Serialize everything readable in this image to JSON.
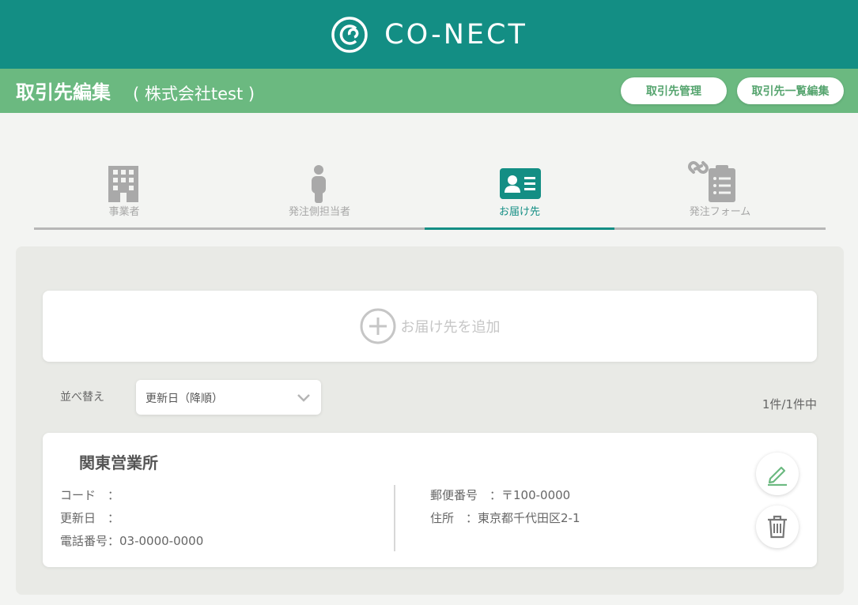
{
  "brand": {
    "name": "CO-NECT",
    "icon": "conect-logo-icon"
  },
  "header": {
    "title": "取引先編集",
    "subtitle": "( 株式会社test )",
    "buttons": {
      "manage": "取引先管理",
      "list_edit": "取引先一覧編集"
    }
  },
  "tabs": [
    {
      "label": "事業者",
      "icon": "building-icon",
      "active": false
    },
    {
      "label": "発注側担当者",
      "icon": "person-icon",
      "active": false
    },
    {
      "label": "お届け先",
      "icon": "id-card-icon",
      "active": true
    },
    {
      "label": "発注フォーム",
      "icon": "linked-clipboard-icon",
      "active": false
    }
  ],
  "add_destination": {
    "label": "お届け先を追加",
    "icon": "plus-circle-icon"
  },
  "sort": {
    "label": "並べ替え",
    "selected": "更新日（降順）",
    "icon": "chevron-down-icon"
  },
  "count": "1件/1件中",
  "destination": {
    "name": "関東営業所",
    "code_line": "コード　：",
    "updated_line": "更新日　：",
    "phone_line": "電話番号：03-0000-0000",
    "postal_line": "郵便番号　：〒100-0000",
    "address_line": "住所　：東京都千代田区2-1",
    "edit_icon": "pencil-icon",
    "delete_icon": "trash-icon"
  },
  "colors": {
    "primary": "#138e84",
    "secondary": "#6bb980",
    "button_text": "#55a46e",
    "inactive": "#a7a7a7"
  }
}
